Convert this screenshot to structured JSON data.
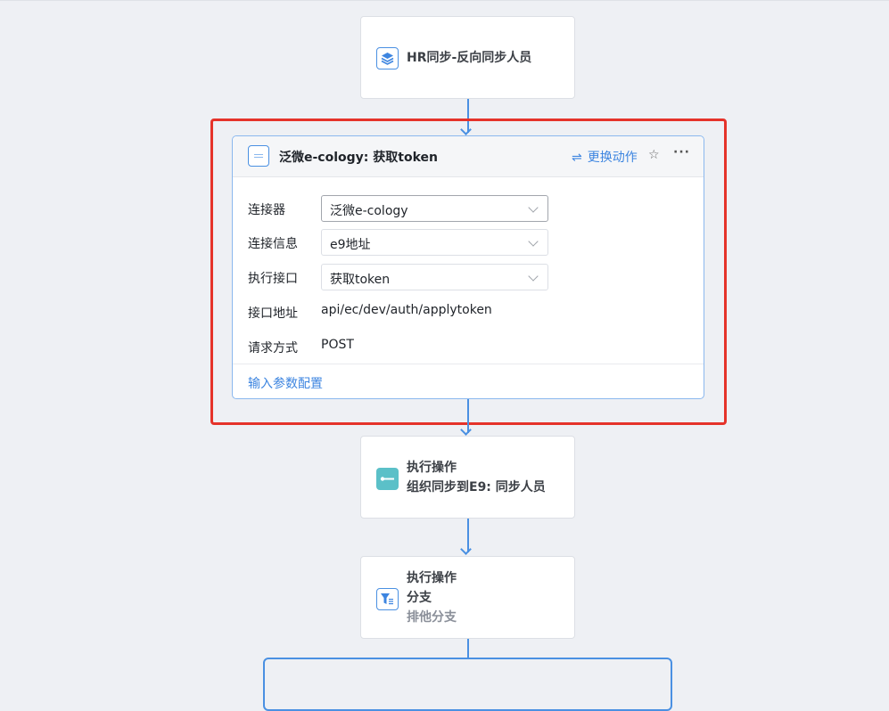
{
  "node_hr": {
    "title": "HR同步-反向同步人员"
  },
  "card": {
    "title": "泛微e-cology: 获取token",
    "action_label": "更换动作",
    "fields": {
      "connector": {
        "label": "连接器",
        "value": "泛微e-cology"
      },
      "connection_info": {
        "label": "连接信息",
        "value": "e9地址"
      },
      "exec_interface": {
        "label": "执行接口",
        "value": "获取token"
      },
      "interface_address": {
        "label": "接口地址",
        "value": "api/ec/dev/auth/applytoken"
      },
      "request_method": {
        "label": "请求方式",
        "value": "POST"
      }
    },
    "footer_link": "输入参数配置"
  },
  "node_exec": {
    "line1": "执行操作",
    "line2": "组织同步到E9: 同步人员"
  },
  "node_branch": {
    "line1": "执行操作",
    "line2": "分支",
    "line3": "排他分支"
  },
  "icons": {
    "hr_node": "layers-icon",
    "card_header": "connector-icon",
    "swap": "swap-arrows-icon",
    "pin": "pin-icon",
    "more": "more-icon",
    "exec_node": "operation-icon",
    "branch_node": "filter-icon"
  },
  "colors": {
    "accent": "#3d85e0",
    "highlight": "#e5332a",
    "connector": "#4a90e2",
    "exec_icon": "#5bc0c8"
  }
}
